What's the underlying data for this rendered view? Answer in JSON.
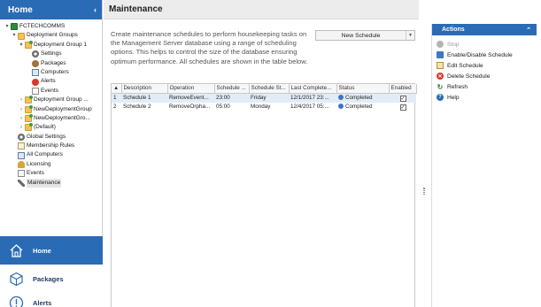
{
  "left_pane": {
    "title": "Home",
    "collapse_glyph": "‹",
    "tree": [
      {
        "label": "FCTECHCOMMS",
        "icon": "server-icon",
        "expander": "▾",
        "indent": 0
      },
      {
        "label": "Deployment Groups",
        "icon": "folder-icon",
        "expander": "▾",
        "indent": 1
      },
      {
        "label": "Deployment Group 1",
        "icon": "deployment-group-icon",
        "expander": "▾",
        "indent": 2
      },
      {
        "label": "Settings",
        "icon": "gear-icon",
        "expander": "",
        "indent": 3
      },
      {
        "label": "Packages",
        "icon": "package-icon",
        "expander": "",
        "indent": 3
      },
      {
        "label": "Computers",
        "icon": "computers-icon",
        "expander": "",
        "indent": 3
      },
      {
        "label": "Alerts",
        "icon": "alert-icon",
        "expander": "",
        "indent": 3
      },
      {
        "label": "Events",
        "icon": "events-icon",
        "expander": "",
        "indent": 3
      },
      {
        "label": "Deployment Group ...",
        "icon": "deployment-group-icon",
        "expander": "›",
        "indent": 2
      },
      {
        "label": "NewDeploymentGroup",
        "icon": "deployment-group-icon",
        "expander": "›",
        "indent": 2
      },
      {
        "label": "NewDeploymentGro...",
        "icon": "deployment-group-icon",
        "expander": "›",
        "indent": 2
      },
      {
        "label": "(Default)",
        "icon": "deployment-group-icon",
        "expander": "›",
        "indent": 2
      },
      {
        "label": "Global Settings",
        "icon": "gear-icon",
        "expander": "",
        "indent": 1
      },
      {
        "label": "Membership Rules",
        "icon": "rules-icon",
        "expander": "",
        "indent": 1
      },
      {
        "label": "All Computers",
        "icon": "computers-icon",
        "expander": "",
        "indent": 1
      },
      {
        "label": "Licensing",
        "icon": "licensing-icon",
        "expander": "",
        "indent": 1
      },
      {
        "label": "Events",
        "icon": "events-icon",
        "expander": "",
        "indent": 1
      },
      {
        "label": "Maintenance",
        "icon": "wrench-icon",
        "expander": "",
        "indent": 1,
        "selected": true
      }
    ],
    "nav": [
      {
        "label": "Home",
        "icon": "home-icon",
        "active": true
      },
      {
        "label": "Packages",
        "icon": "package-icon",
        "active": false
      },
      {
        "label": "Alerts",
        "icon": "alert-icon",
        "active": false
      }
    ]
  },
  "main": {
    "title": "Maintenance",
    "description": "Create maintenance schedules to perform housekeeping tasks on the Management Server database using a range of scheduling options. This helps to control the size of the database ensuring optimum performance. All schedules are shown in the table below.",
    "new_schedule_label": "New Schedule",
    "table": {
      "columns": [
        "▲",
        "Description",
        "Operation",
        "Schedule ...",
        "Schedule St...",
        "Last Complete...",
        "Status",
        "Enabled"
      ],
      "rows": [
        {
          "num": "1",
          "description": "Schedule 1",
          "operation": "RemoveEvent...",
          "schedule": "23:00",
          "schedule_start": "Friday",
          "last_complete": "12/1/2017 23:...",
          "status": "Completed",
          "enabled": true
        },
        {
          "num": "2",
          "description": "Schedule 2",
          "operation": "RemoveOrpha...",
          "schedule": "05:00",
          "schedule_start": "Monday",
          "last_complete": "12/4/2017 05:...",
          "status": "Completed",
          "enabled": true
        }
      ]
    }
  },
  "actions": {
    "title": "Actions",
    "collapse_glyph": "⌃",
    "items": [
      {
        "label": "Stop",
        "icon": "stop-icon",
        "enabled": false
      },
      {
        "label": "Enable/Disable Schedule",
        "icon": "toggle-icon",
        "enabled": true
      },
      {
        "label": "Edit Schedule",
        "icon": "edit-icon",
        "enabled": true
      },
      {
        "label": "Delete Schedule",
        "icon": "delete-icon",
        "enabled": true
      },
      {
        "label": "Refresh",
        "icon": "refresh-icon",
        "enabled": true
      },
      {
        "label": "Help",
        "icon": "help-icon",
        "enabled": true
      }
    ]
  },
  "colors": {
    "accent_blue": "#2a6bb5",
    "header_gray": "#ececec",
    "selected_row": "#e2ecf7",
    "status_blue": "#3b73c8"
  }
}
